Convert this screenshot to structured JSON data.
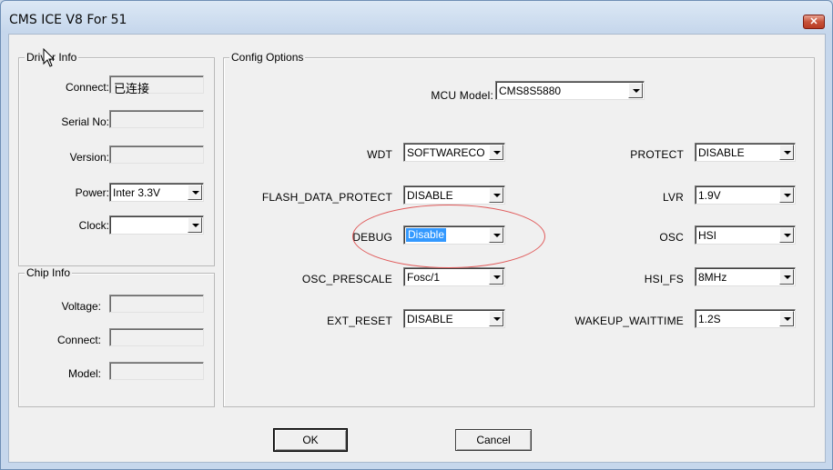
{
  "window": {
    "title": "CMS ICE V8 For 51",
    "close_glyph": "✕"
  },
  "driver_info": {
    "title": "Driver Info",
    "connect_label": "Connect:",
    "connect_value": "已连接",
    "serial_label": "Serial No:",
    "version_label": "Version:",
    "power_label": "Power:",
    "power_value": "Inter 3.3V",
    "clock_label": "Clock:",
    "clock_value": ""
  },
  "chip_info": {
    "title": "Chip Info",
    "voltage_label": "Voltage:",
    "connect_label": "Connect:",
    "model_label": "Model:"
  },
  "config": {
    "title": "Config Options",
    "mcu_label": "MCU Model:",
    "mcu_value": "CMS8S5880",
    "left": [
      {
        "label": "WDT",
        "value": "SOFTWARECO"
      },
      {
        "label": "FLASH_DATA_PROTECT",
        "value": "DISABLE"
      },
      {
        "label": "DEBUG",
        "value": "Disable"
      },
      {
        "label": "OSC_PRESCALE",
        "value": "Fosc/1"
      },
      {
        "label": "EXT_RESET",
        "value": "DISABLE"
      }
    ],
    "right": [
      {
        "label": "PROTECT",
        "value": "DISABLE"
      },
      {
        "label": "LVR",
        "value": "1.9V"
      },
      {
        "label": "OSC",
        "value": "HSI"
      },
      {
        "label": "HSI_FS",
        "value": "8MHz"
      },
      {
        "label": "WAKEUP_WAITTIME",
        "value": "1.2S"
      }
    ]
  },
  "buttons": {
    "ok": "OK",
    "cancel": "Cancel"
  },
  "annotation": {
    "color": "#e05a5a"
  }
}
